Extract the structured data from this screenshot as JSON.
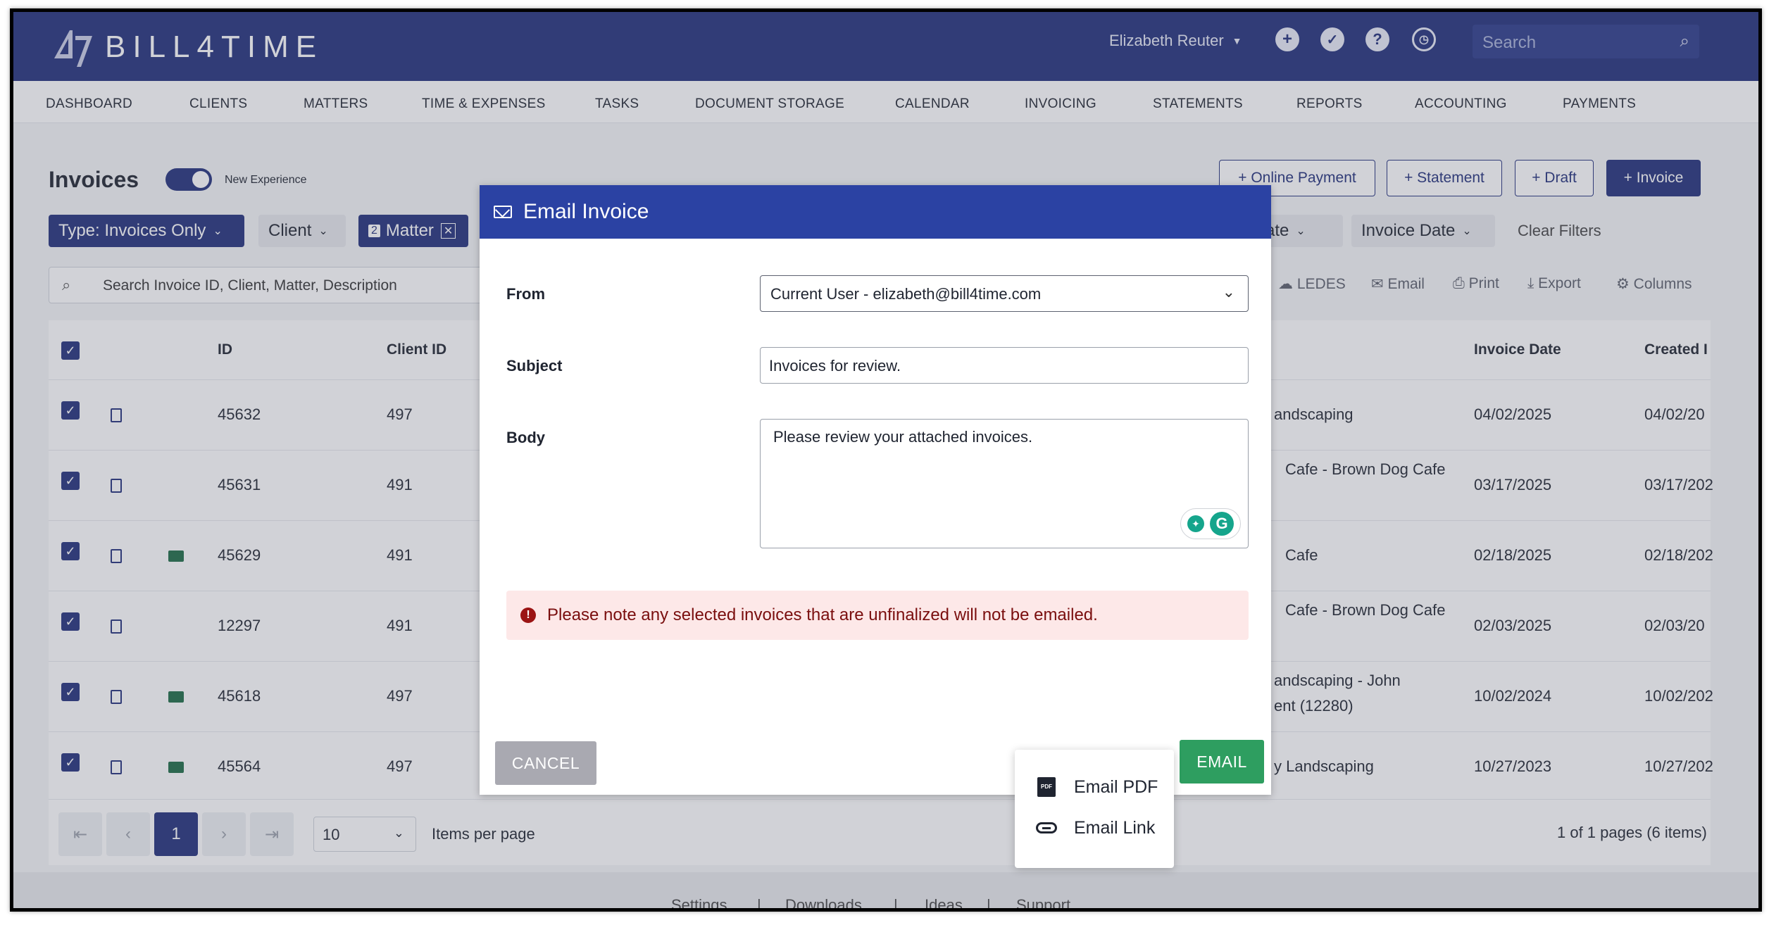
{
  "app": {
    "logo_text": "BILL4TIME"
  },
  "header": {
    "user_name": "Elizabeth Reuter",
    "search_placeholder": "Search",
    "icons": [
      "plus-circle-icon",
      "check-circle-icon",
      "help-circle-icon",
      "clock-icon",
      "search-icon"
    ]
  },
  "nav": [
    "DASHBOARD",
    "CLIENTS",
    "MATTERS",
    "TIME & EXPENSES",
    "TASKS",
    "DOCUMENT STORAGE",
    "CALENDAR",
    "INVOICING",
    "STATEMENTS",
    "REPORTS",
    "ACCOUNTING",
    "PAYMENTS"
  ],
  "page": {
    "title": "Invoices",
    "new_experience_label": "New Experience",
    "new_experience_on": true,
    "buttons": {
      "online_payment": "+ Online Payment",
      "statement": "+ Statement",
      "draft": "+ Draft",
      "invoice": "+ Invoice"
    },
    "filters": {
      "type": "Type: Invoices Only",
      "client": "Client",
      "matter_count": "2",
      "matter": "Matter",
      "date_partial": "ate",
      "invoice_date": "Invoice Date",
      "clear": "Clear Filters"
    },
    "search_placeholder": "Search Invoice ID, Client, Matter, Description",
    "tools": {
      "ledes": "LEDES",
      "email": "Email",
      "print": "Print",
      "export": "Export",
      "columns": "Columns"
    }
  },
  "table": {
    "headers": {
      "id": "ID",
      "client_id": "Client ID",
      "invoice_date": "Invoice Date",
      "created": "Created I"
    },
    "rows": [
      {
        "id": "45632",
        "client_id": "497",
        "matter_a": "andscaping",
        "matter_b": "",
        "invoice_date": "04/02/2025",
        "created": "04/02/20",
        "emailed": false
      },
      {
        "id": "45631",
        "client_id": "491",
        "matter_a": "Cafe - Brown Dog Cafe",
        "matter_b": "",
        "invoice_date": "03/17/2025",
        "created": "03/17/202",
        "emailed": false
      },
      {
        "id": "45629",
        "client_id": "491",
        "matter_a": "Cafe",
        "matter_b": "",
        "invoice_date": "02/18/2025",
        "created": "02/18/202",
        "emailed": true
      },
      {
        "id": "12297",
        "client_id": "491",
        "matter_a": "Cafe - Brown Dog Cafe",
        "matter_b": "",
        "invoice_date": "02/03/2025",
        "created": "02/03/20",
        "emailed": false
      },
      {
        "id": "45618",
        "client_id": "497",
        "matter_a": "andscaping - John",
        "matter_b": "ent (12280)",
        "invoice_date": "10/02/2024",
        "created": "10/02/202",
        "emailed": true
      },
      {
        "id": "45564",
        "client_id": "497",
        "matter_a": "y Landscaping",
        "matter_b": "",
        "invoice_date": "10/27/2023",
        "created": "10/27/202",
        "emailed": true
      }
    ]
  },
  "pager": {
    "current": "1",
    "per_page": "10",
    "per_page_label": "Items per page",
    "summary": "1 of 1 pages (6 items)"
  },
  "footer": [
    "Settings",
    "|",
    "Downloads",
    "|",
    "Ideas",
    "|",
    "Support"
  ],
  "modal": {
    "title": "Email Invoice",
    "from_label": "From",
    "from_value": "Current User - elizabeth@bill4time.com",
    "subject_label": "Subject",
    "subject_value": "Invoices for review.",
    "body_label": "Body",
    "body_value": "Please review your attached invoices.",
    "notice": "Please note any selected invoices that are unfinalized will not be emailed.",
    "cancel": "CANCEL",
    "email": "EMAIL"
  },
  "email_menu": {
    "pdf": "Email PDF",
    "link": "Email Link"
  },
  "colors": {
    "brand": "#22307a",
    "modal_header": "#2b42a3",
    "email_green": "#2e9e60",
    "notice_bg": "#fde8e8",
    "notice_text": "#7a0e0e"
  }
}
